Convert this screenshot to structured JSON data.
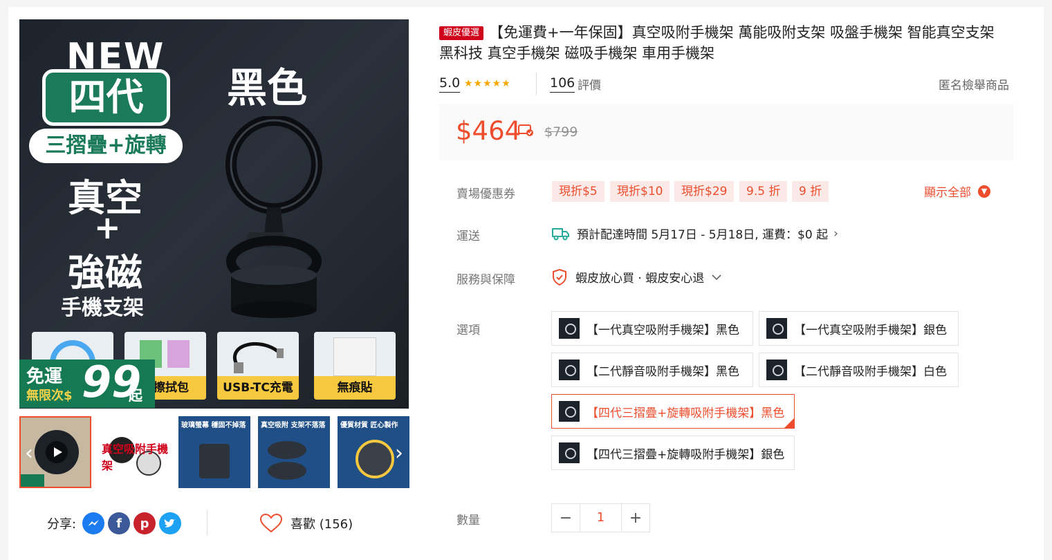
{
  "gallery": {
    "main": {
      "new_text": "NEW",
      "gen_text": "四代",
      "feature_pill": "三摺疊+旋轉",
      "vacuum_text": "真空",
      "plus_text": "+",
      "magnet_text": "強磁",
      "holder_text": "手機支架",
      "color_text": "黑色",
      "tiles": [
        "",
        "清擦拭包",
        "USB-TC充電線",
        "無痕貼"
      ],
      "free_badge": {
        "line1": "免運",
        "line2": "無限次",
        "dollar": "$",
        "number": "99",
        "suffix": "起"
      }
    },
    "thumbnails": [
      {
        "caption": "",
        "selected": true
      },
      {
        "caption": "真空吸附手機架",
        "selected": false
      },
      {
        "caption": "玻璃螢幕 穩固不掉落",
        "selected": false
      },
      {
        "caption": "真空吸附 支架不落落",
        "selected": false
      },
      {
        "caption": "優質材質 匠心製作",
        "selected": false
      }
    ]
  },
  "share": {
    "label": "分享:",
    "icons": [
      "messenger-icon",
      "facebook-icon",
      "pinterest-icon",
      "twitter-icon"
    ]
  },
  "like": {
    "label": "喜歡 (156)"
  },
  "product": {
    "tag": "蝦皮優選",
    "title": "【免運費+一年保固】真空吸附手機架 萬能吸附支架 吸盤手機架 智能真空支架 黑科技 真空手機架 磁吸手機架 車用手機架",
    "rating": "5.0",
    "stars": "★★★★★",
    "review_count": "106",
    "review_label": "評價",
    "report": "匿名檢舉商品"
  },
  "price": {
    "current": "$464",
    "original": "$799"
  },
  "vouchers": {
    "label": "賣場優惠券",
    "items": [
      "現折$5",
      "現折$10",
      "現折$29",
      "9.5 折",
      "9 折"
    ],
    "show_all": "顯示全部"
  },
  "shipping": {
    "label": "運送",
    "text": "預計配達時間 5月17日 - 5月18日, 運費：$0 起"
  },
  "service": {
    "label": "服務與保障",
    "text": "蝦皮放心買 · 蝦皮安心退"
  },
  "options": {
    "label": "選項",
    "items": [
      "【一代真空吸附手機架】黑色",
      "【一代真空吸附手機架】銀色",
      "【二代靜音吸附手機架】黑色",
      "【二代靜音吸附手機架】白色",
      "【四代三摺疊+旋轉吸附手機架】黑色",
      "【四代三摺疊+旋轉吸附手機架】銀色"
    ],
    "selected_index": 4
  },
  "quantity": {
    "label": "數量",
    "value": "1",
    "minus": "−",
    "plus": "+"
  },
  "colors": {
    "accent": "#ee4d2d",
    "tag_red": "#d0011b",
    "star": "#f6a700",
    "brand_green": "#1a7a5a"
  }
}
